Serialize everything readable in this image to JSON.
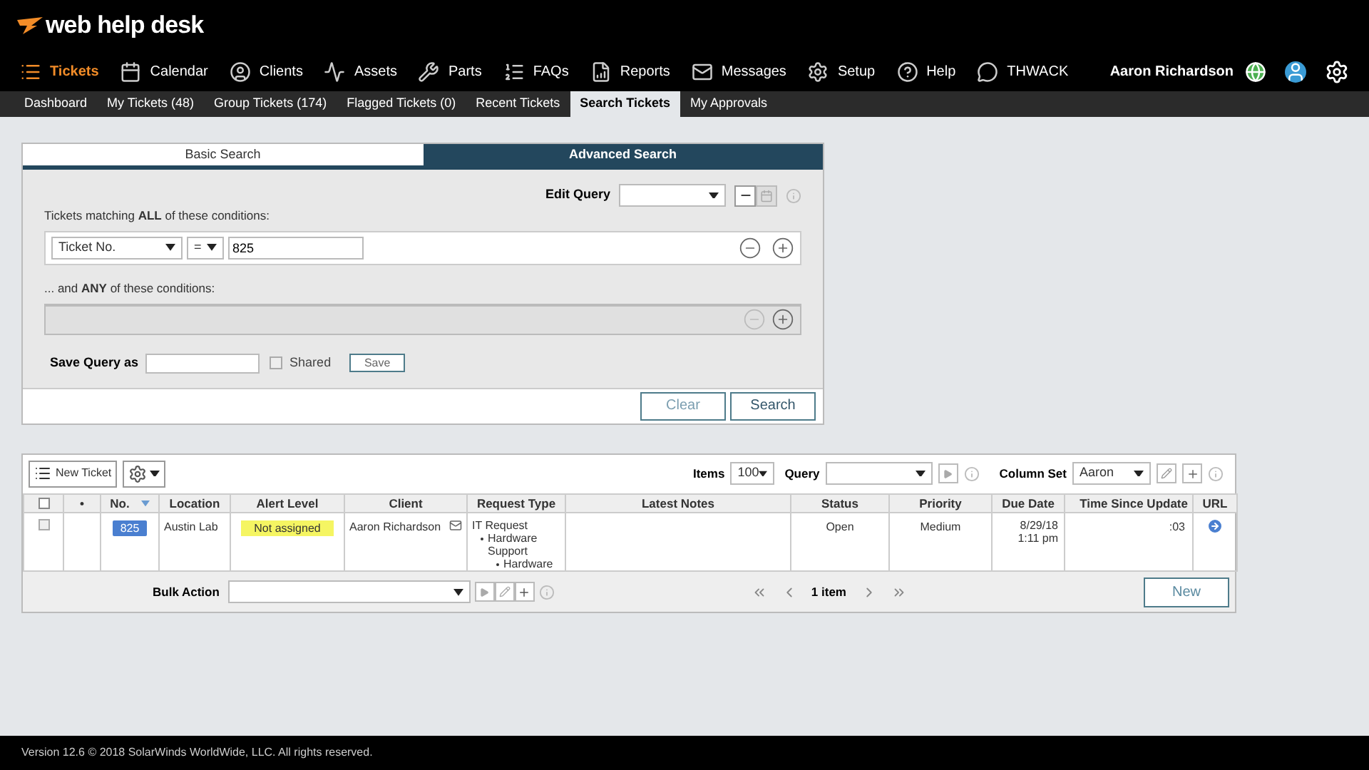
{
  "logo": {
    "text": "web help desk"
  },
  "nav": [
    {
      "label": "Tickets",
      "selected": true
    },
    {
      "label": "Calendar",
      "selected": false
    },
    {
      "label": "Clients",
      "selected": false
    },
    {
      "label": "Assets",
      "selected": false
    },
    {
      "label": "Parts",
      "selected": false
    },
    {
      "label": "FAQs",
      "selected": false
    },
    {
      "label": "Reports",
      "selected": false
    },
    {
      "label": "Messages",
      "selected": false
    },
    {
      "label": "Setup",
      "selected": false
    },
    {
      "label": "Help",
      "selected": false
    },
    {
      "label": "THWACK",
      "selected": false
    }
  ],
  "user": {
    "name": "Aaron Richardson"
  },
  "subnav": [
    {
      "label": "Dashboard",
      "selected": false
    },
    {
      "label": "My Tickets (48)",
      "selected": false
    },
    {
      "label": "Group Tickets (174)",
      "selected": false
    },
    {
      "label": "Flagged Tickets (0)",
      "selected": false
    },
    {
      "label": "Recent Tickets",
      "selected": false
    },
    {
      "label": "Search Tickets",
      "selected": true
    },
    {
      "label": "My Approvals",
      "selected": false
    }
  ],
  "search_tabs": [
    {
      "label": "Basic Search",
      "selected": false
    },
    {
      "label": "Advanced Search",
      "selected": true
    }
  ],
  "edit_query": {
    "label": "Edit Query"
  },
  "all_conditions": {
    "label": "Tickets matching **ALL** of these conditions:",
    "field": "Ticket No.",
    "operator": "=",
    "value": "825"
  },
  "any_conditions": {
    "label": "... and **ANY** of these conditions:"
  },
  "save_query": {
    "label": "Save Query as",
    "shared_label": "Shared",
    "shared_checked": false,
    "save_button": "Save"
  },
  "search_buttons": [
    "Clear",
    "Search"
  ],
  "toolbar": {
    "new_ticket": "New Ticket",
    "items_label": "Items",
    "items_value": "100",
    "query_label": "Query",
    "column_set_label": "Column Set",
    "column_set_value": "Aaron"
  },
  "table": {
    "select_all_checked": false,
    "columns": [
      "•",
      "No.",
      "Location",
      "Alert Level",
      "Client",
      "Request Type",
      "Latest Notes",
      "Status",
      "Priority",
      "Due Date",
      "Time Since Update",
      "URL"
    ],
    "rows": [
      {
        "selected": false,
        "number": "825",
        "location": "Austin Lab",
        "alert_level": "Not assigned",
        "client": "Aaron Richardson",
        "request_type": {
          "label": "IT Request",
          "children": [
            {
              "label": "Hardware Support",
              "children": [
                {
                  "label": "Hardware"
                }
              ]
            }
          ]
        },
        "status": "Open",
        "priority": "Medium",
        "due_date": "8/29/18",
        "due_time": "1:11 pm",
        "time_since_update": ":03"
      }
    ]
  },
  "bulk": {
    "label": "Bulk Action",
    "pager": "1 item",
    "new_button": "New"
  },
  "footer": {
    "text": "Version 12.6 © 2018 SolarWinds WorldWide, LLC. All rights reserved."
  }
}
